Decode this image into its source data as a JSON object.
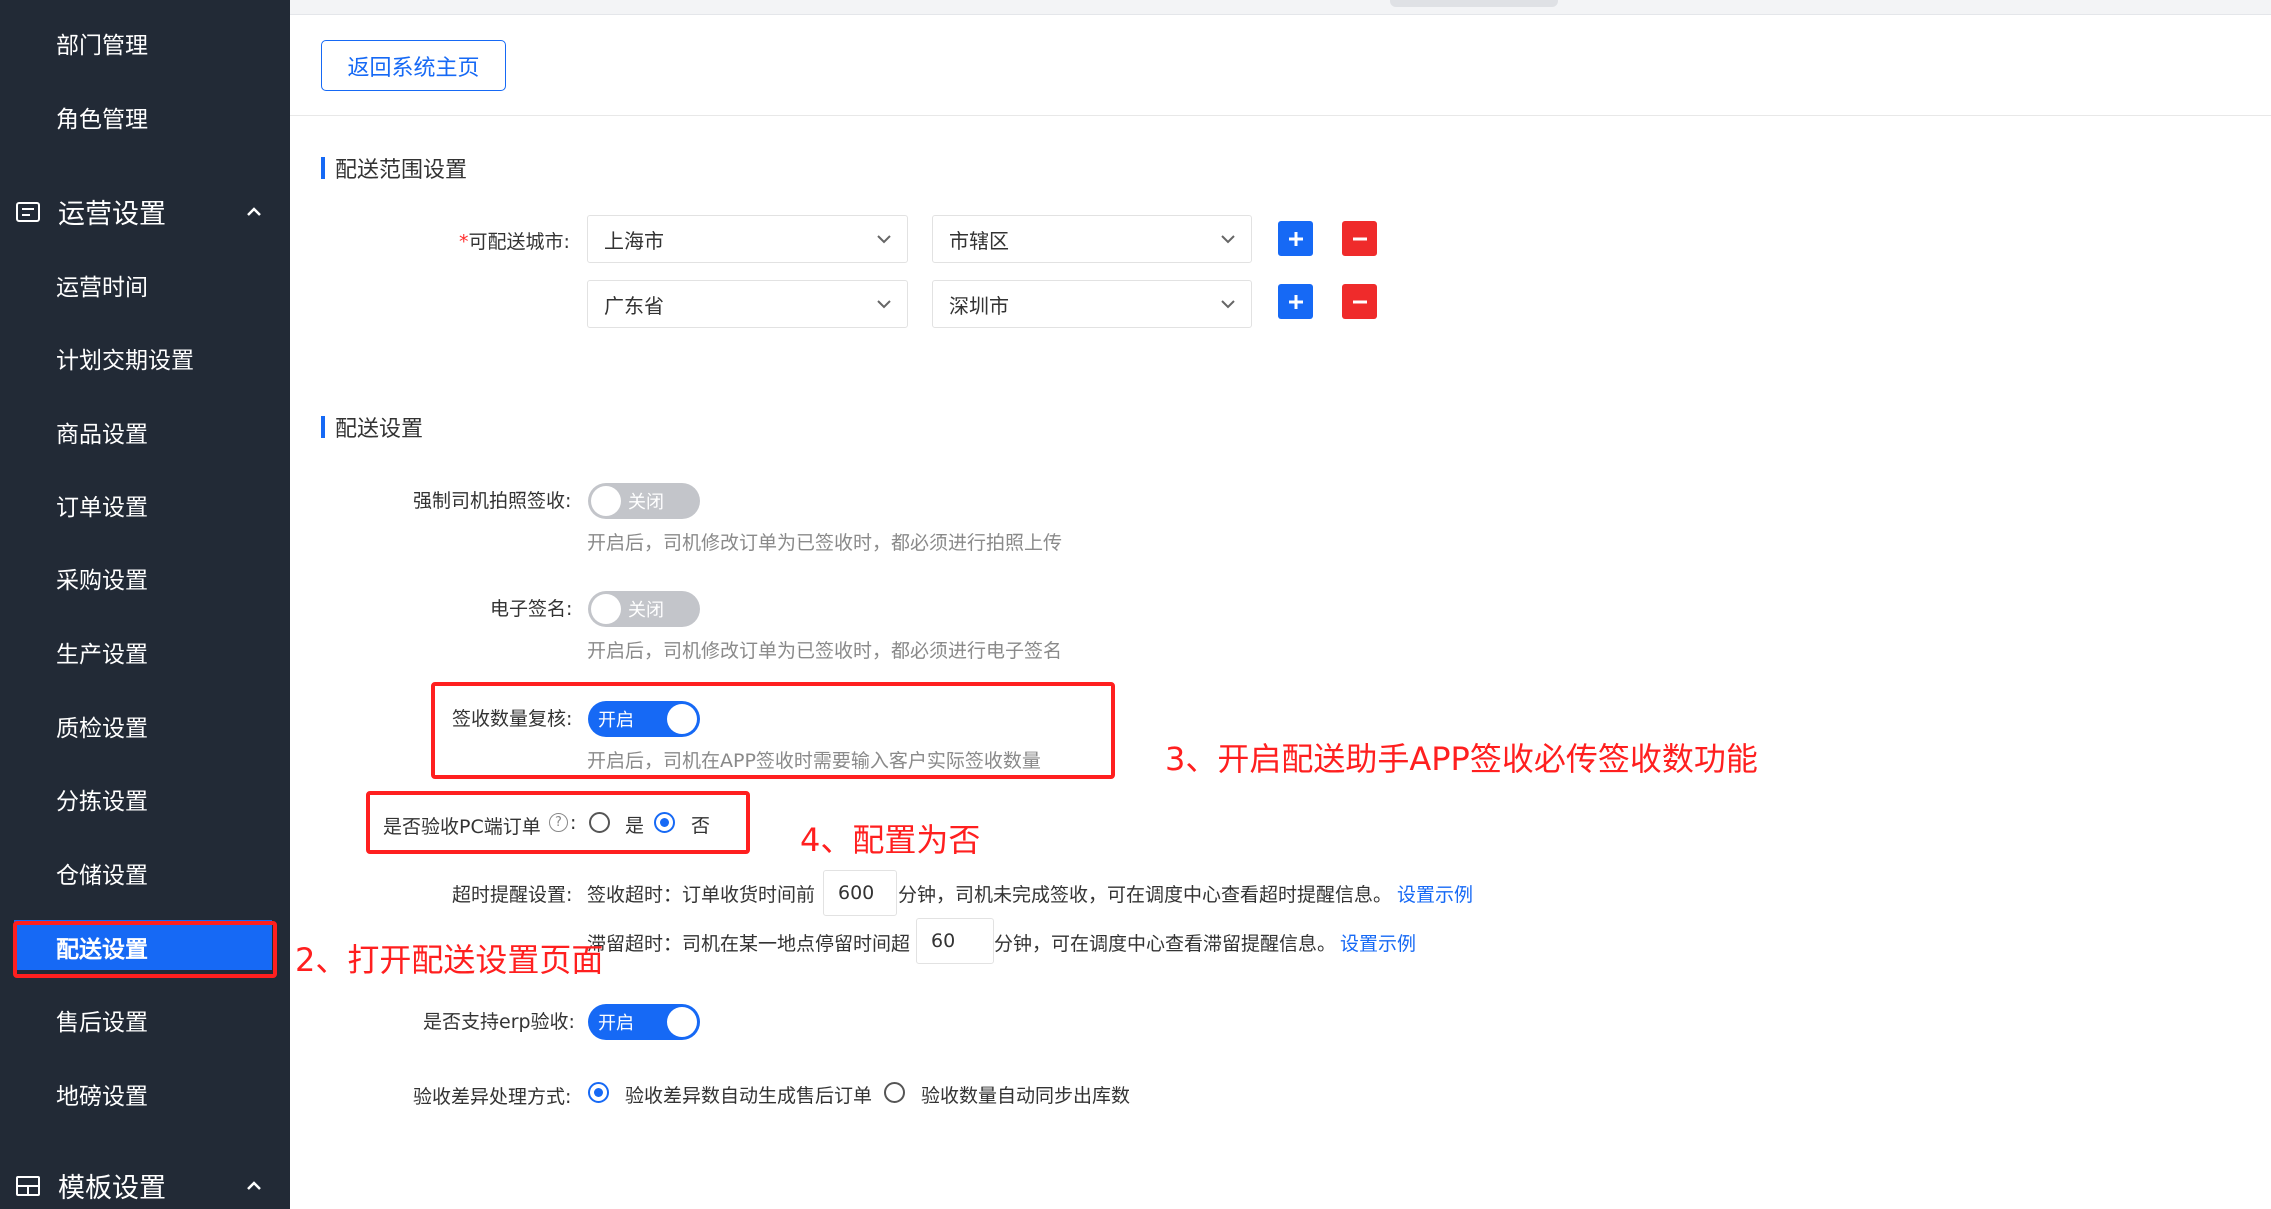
{
  "sidebar": {
    "items_top": [
      "部门管理",
      "角色管理"
    ],
    "group_ops": "运营设置",
    "ops_items": [
      "运营时间",
      "计划交期设置",
      "商品设置",
      "订单设置",
      "采购设置",
      "生产设置",
      "质检设置",
      "分拣设置",
      "仓储设置",
      "配送设置",
      "售后设置",
      "地磅设置"
    ],
    "group_template": "模板设置",
    "active_item": "配送设置"
  },
  "header": {
    "back_button": "返回系统主页"
  },
  "range_section": {
    "title": "配送范围设置",
    "required_mark": "*",
    "city_label": "可配送城市:",
    "rows": [
      {
        "province": "上海市",
        "city": "市辖区"
      },
      {
        "province": "广东省",
        "city": "深圳市"
      }
    ],
    "add_symbol": "+",
    "remove_symbol": "−"
  },
  "delivery_section": {
    "title": "配送设置",
    "photo_sign": {
      "label": "强制司机拍照签收:",
      "state": "关闭",
      "hint": "开启后，司机修改订单为已签收时，都必须进行拍照上传"
    },
    "e_sign": {
      "label": "电子签名:",
      "state": "关闭",
      "hint": "开启后，司机修改订单为已签收时，都必须进行电子签名"
    },
    "qty_check": {
      "label": "签收数量复核:",
      "state": "开启",
      "hint": "开启后，司机在APP签收时需要输入客户实际签收数量"
    },
    "pc_check": {
      "label": "是否验收PC端订单",
      "help": "?",
      "colon": ":",
      "yes": "是",
      "no": "否",
      "selected": "否"
    },
    "timeout": {
      "label": "超时提醒设置:",
      "sign_prefix": "签收超时：订单收货时间前",
      "sign_value": "600",
      "sign_suffix": "分钟，司机未完成签收，可在调度中心查看超时提醒信息。",
      "stay_prefix": "滞留超时：司机在某一地点停留时间超",
      "stay_value": "60",
      "stay_suffix": "分钟，可在调度中心查看滞留提醒信息。",
      "example_link": "设置示例"
    },
    "erp": {
      "label": "是否支持erp验收:",
      "state": "开启"
    },
    "diff": {
      "label": "验收差异处理方式:",
      "option1": "验收差异数自动生成售后订单",
      "option2": "验收数量自动同步出库数",
      "selected": "option1"
    }
  },
  "annotations": {
    "step2": "2、打开配送设置页面",
    "step3": "3、开启配送助手APP签收必传签收数功能",
    "step4": "4、配置为否"
  },
  "colors": {
    "primary": "#1669f5",
    "danger": "#ef2b2b",
    "annotation": "#ff1f1f",
    "sidebar_bg": "#222a36"
  }
}
